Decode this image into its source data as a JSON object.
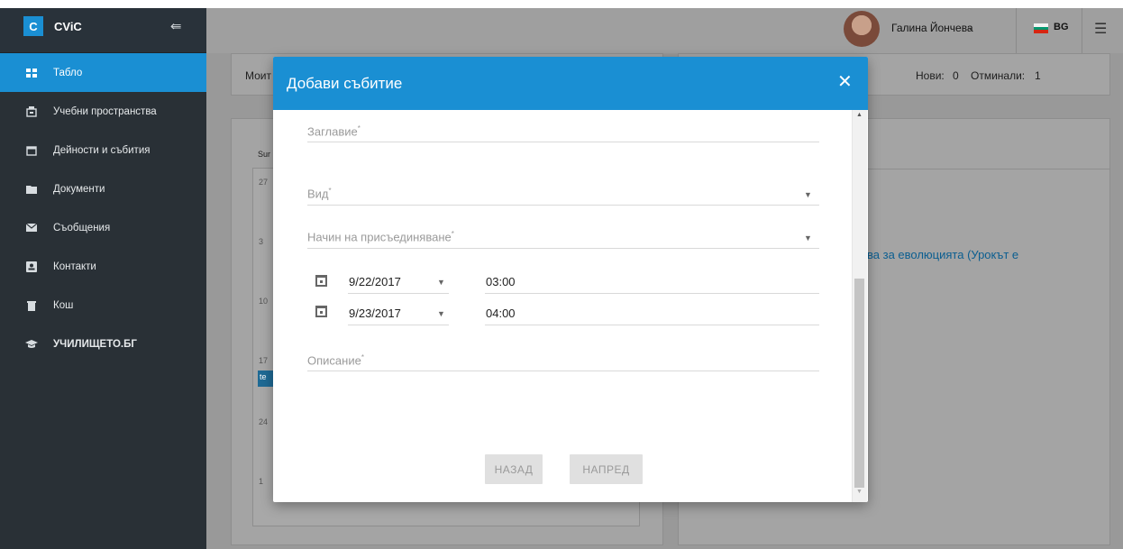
{
  "sidebar": {
    "brand_badge": "C",
    "brand_name": "CViC",
    "items": [
      {
        "label": "Табло",
        "icon": "dashboard-icon"
      },
      {
        "label": "Учебни пространства",
        "icon": "classroom-icon"
      },
      {
        "label": "Дейности и събития",
        "icon": "calendar-icon"
      },
      {
        "label": "Документи",
        "icon": "folder-icon"
      },
      {
        "label": "Съобщения",
        "icon": "envelope-icon"
      },
      {
        "label": "Контакти",
        "icon": "contact-card-icon"
      },
      {
        "label": "Кош",
        "icon": "trash-icon"
      },
      {
        "label": "УЧИЛИЩЕТО.БГ",
        "icon": "graduation-cap-icon"
      }
    ]
  },
  "header": {
    "user_name": "Галина Йончева",
    "language": "BG"
  },
  "background": {
    "card1_text": "Моит",
    "stats_new_label": "Нови:",
    "stats_new_value": "0",
    "stats_missed_label": "Отминали:",
    "stats_missed_value": "1",
    "calendar_day_header": "Sur",
    "calendar_days": [
      "27",
      "3",
      "10",
      "17",
      "24",
      "1"
    ],
    "event_chip": "te",
    "link_text": "ва за еволюцията (Урокът е"
  },
  "modal": {
    "title": "Добави събитие",
    "fields": {
      "title_label": "Заглавие",
      "type_label": "Вид",
      "join_method_label": "Начин на присъединяване",
      "description_label": "Описание",
      "required_mark": "*"
    },
    "start_date": "9/22/2017",
    "start_time": "03:00",
    "end_date": "9/23/2017",
    "end_time": "04:00",
    "back_button": "НАЗАД",
    "next_button": "НАПРЕД"
  },
  "colors": {
    "accent": "#1a8fd3",
    "sidebar_bg": "#293036"
  }
}
